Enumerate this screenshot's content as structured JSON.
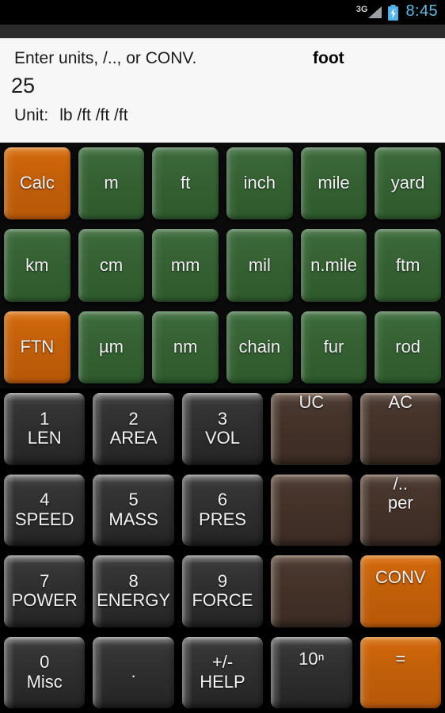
{
  "statusbar": {
    "network": "3G",
    "signal_icon": "signal-bars-icon",
    "battery_icon": "battery-charging-icon",
    "time": "8:45"
  },
  "header": {
    "prompt": "Enter units, /.., or CONV.",
    "target_unit": "foot",
    "value": "25",
    "unit_label": "Unit:",
    "unit_value": "lb /ft /ft /ft"
  },
  "unit_keys": [
    {
      "label": "Calc",
      "style": "orange"
    },
    {
      "label": "m",
      "style": "green"
    },
    {
      "label": "ft",
      "style": "green"
    },
    {
      "label": "inch",
      "style": "green"
    },
    {
      "label": "mile",
      "style": "green"
    },
    {
      "label": "yard",
      "style": "green"
    },
    {
      "label": "km",
      "style": "green"
    },
    {
      "label": "cm",
      "style": "green"
    },
    {
      "label": "mm",
      "style": "green"
    },
    {
      "label": "mil",
      "style": "green"
    },
    {
      "label": "n.mile",
      "style": "green"
    },
    {
      "label": "ftm",
      "style": "green"
    },
    {
      "label": "FTN",
      "style": "orange"
    },
    {
      "label": "µm",
      "style": "green"
    },
    {
      "label": "nm",
      "style": "green"
    },
    {
      "label": "chain",
      "style": "green"
    },
    {
      "label": "fur",
      "style": "green"
    },
    {
      "label": "rod",
      "style": "green"
    }
  ],
  "keypad_keys": [
    {
      "top": "1",
      "sub": "LEN",
      "style": "dark"
    },
    {
      "top": "2",
      "sub": "AREA",
      "style": "dark"
    },
    {
      "top": "3",
      "sub": "VOL",
      "style": "dark"
    },
    {
      "top": "UC",
      "sub": "",
      "style": "brown"
    },
    {
      "top": "AC",
      "sub": "",
      "style": "brown"
    },
    {
      "top": "4",
      "sub": "SPEED",
      "style": "dark"
    },
    {
      "top": "5",
      "sub": "MASS",
      "style": "dark"
    },
    {
      "top": "6",
      "sub": "PRES",
      "style": "dark"
    },
    {
      "top": "",
      "sub": "",
      "style": "brown"
    },
    {
      "top": "/..",
      "sub": "per",
      "style": "brown"
    },
    {
      "top": "7",
      "sub": "POWER",
      "style": "dark"
    },
    {
      "top": "8",
      "sub": "ENERGY",
      "style": "dark"
    },
    {
      "top": "9",
      "sub": "FORCE",
      "style": "dark"
    },
    {
      "top": "",
      "sub": "",
      "style": "brown"
    },
    {
      "top": "CONV",
      "sub": "",
      "style": "orange"
    },
    {
      "top": "0",
      "sub": "Misc",
      "style": "dark"
    },
    {
      "top": ".",
      "sub": "",
      "style": "dark"
    },
    {
      "top": "+/-",
      "sub": "HELP",
      "style": "dark"
    },
    {
      "top": "10ⁿ",
      "sub": "",
      "style": "dark"
    },
    {
      "top": "=",
      "sub": "",
      "style": "orange"
    }
  ],
  "colors": {
    "green": "#356033",
    "orange": "#c25f09",
    "dark_key": "#303030",
    "brown_key": "#443229",
    "header_bg": "#f7f7f7",
    "status_time": "#63b8e3"
  }
}
